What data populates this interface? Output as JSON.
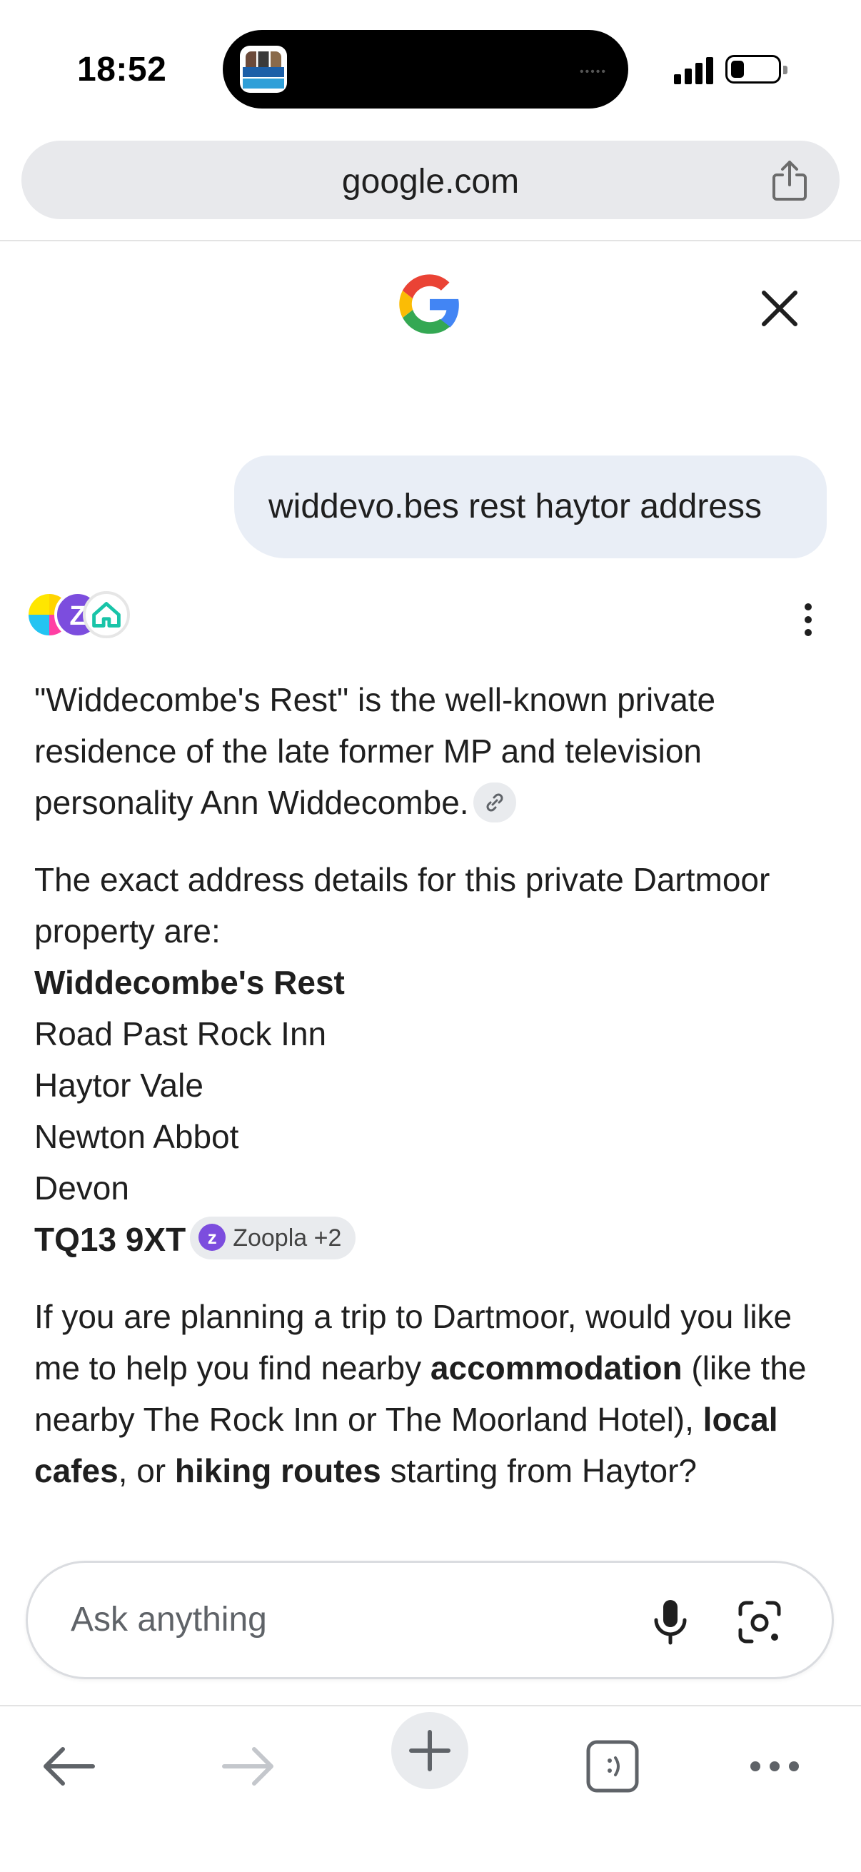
{
  "status_bar": {
    "time": "18:52",
    "island_app_icon": "news-agents-podcast-icon",
    "signal": "cellular-signal-icon",
    "battery": "battery-low-icon"
  },
  "browser": {
    "url": "google.com",
    "share_icon": "share-icon"
  },
  "header": {
    "logo_icon": "google-g-icon",
    "close_icon": "close-icon"
  },
  "conversation": {
    "user_query": "widdevo.bes rest haytor address",
    "sources_icons": [
      "source-icon-colorful",
      "zoopla-icon",
      "home-icon"
    ],
    "answer": {
      "p1": "\"Widdecombe's Rest\" is the well-known private residence of the late former MP and television personality Ann Widdecombe.",
      "p2": "The exact address details for this private Dartmoor property are:",
      "address_name": "Widdecombe's Rest",
      "address_lines": [
        "Road Past Rock Inn",
        "Haytor Vale",
        "Newton Abbot",
        "Devon"
      ],
      "postcode": "TQ13 9XT",
      "source_chip": "Zoopla +2",
      "p3_pre": "If you are planning a trip to Dartmoor, would you like me to help you find nearby ",
      "p3_b1": "accommodation",
      "p3_mid1": " (like the nearby The Rock Inn or The Moorland Hotel), ",
      "p3_b2": "local cafes",
      "p3_mid2": ", or ",
      "p3_b3": "hiking routes",
      "p3_post": " starting from Haytor?"
    }
  },
  "input": {
    "placeholder": "Ask anything"
  },
  "colors": {
    "accent_purple": "#7c4dde",
    "chip_bg": "#e9ebee",
    "bubble_bg": "#e9eef6"
  }
}
